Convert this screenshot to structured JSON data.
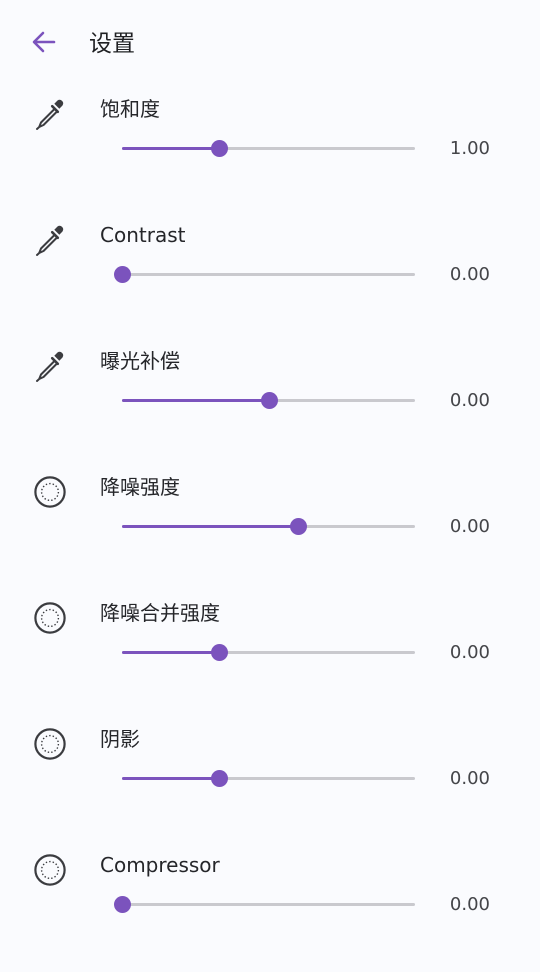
{
  "colors": {
    "accent": "#7b53bd",
    "track": "#c9c9ce",
    "background": "#fafbfe",
    "icon": "#3b3c40"
  },
  "header": {
    "back_icon": "arrow-left-icon",
    "title": "设置"
  },
  "settings": [
    {
      "icon": "eyedropper-icon",
      "label": "饱和度",
      "value": "1.00",
      "level": 0.33
    },
    {
      "icon": "eyedropper-icon",
      "label": "Contrast",
      "value": "0.00",
      "level": 0.0
    },
    {
      "icon": "eyedropper-icon",
      "label": "曝光补偿",
      "value": "0.00",
      "level": 0.5
    },
    {
      "icon": "dotted-circle-icon",
      "label": "降噪强度",
      "value": "0.00",
      "level": 0.6
    },
    {
      "icon": "dotted-circle-icon",
      "label": "降噪合并强度",
      "value": "0.00",
      "level": 0.33
    },
    {
      "icon": "dotted-circle-icon",
      "label": "阴影",
      "value": "0.00",
      "level": 0.33
    },
    {
      "icon": "dotted-circle-icon",
      "label": "Compressor",
      "value": "0.00",
      "level": 0.0
    }
  ]
}
